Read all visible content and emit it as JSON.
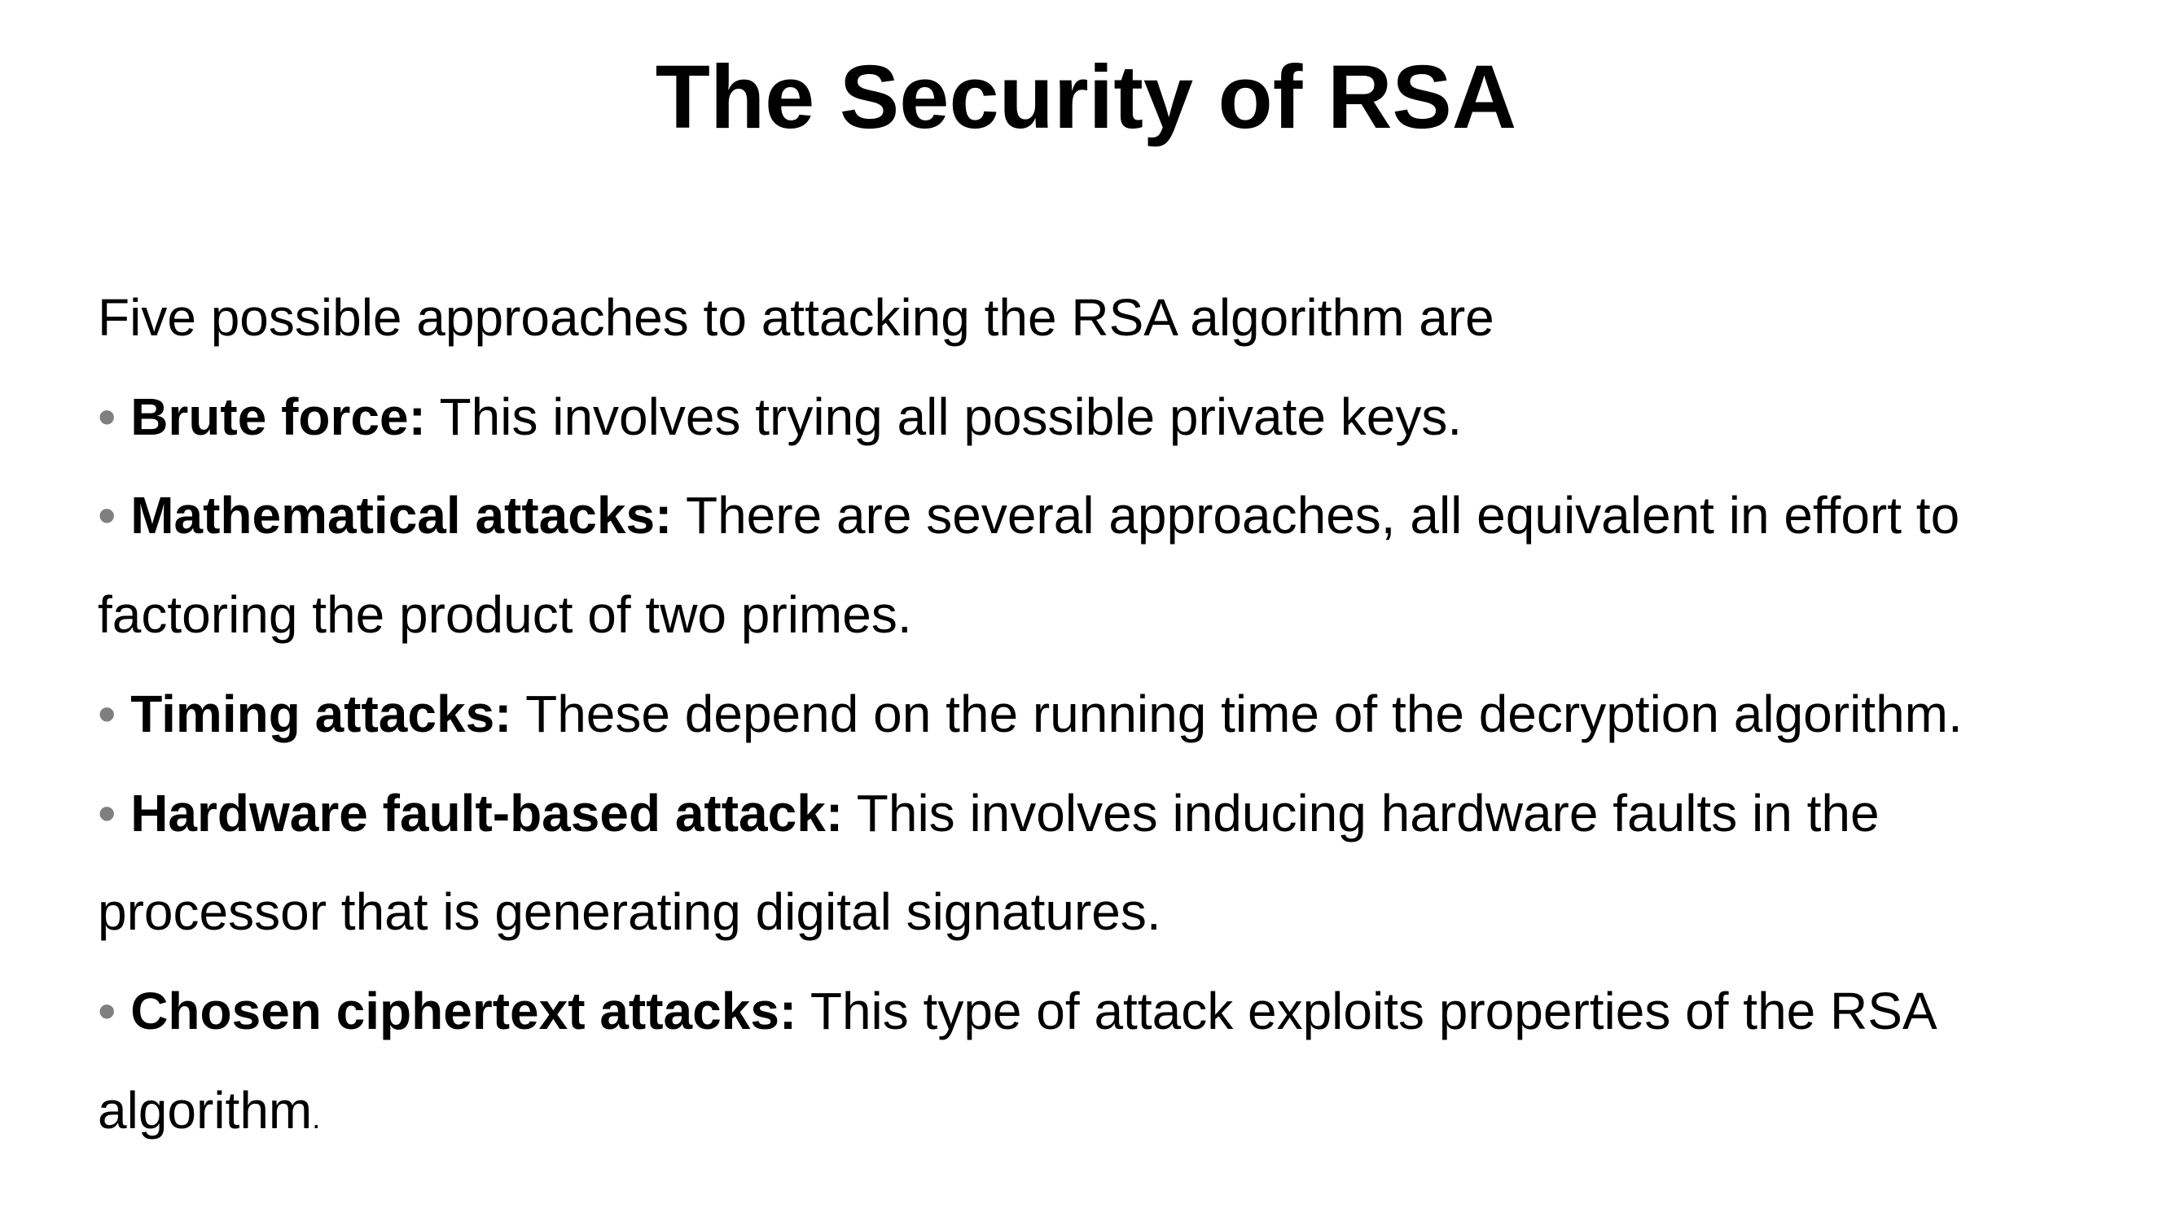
{
  "slide": {
    "title": "The Security of RSA",
    "intro": "Five possible approaches to attacking the RSA algorithm are",
    "bullet_marker": "•",
    "bullets": [
      {
        "term": "Brute force:",
        "text": " This involves trying all possible private keys."
      },
      {
        "term": "Mathematical attacks:",
        "text": " There are several approaches, all equivalent in effort to factoring the product of two primes."
      },
      {
        "term": "Timing attacks:",
        "text": " These depend on the running time of the decryption algorithm."
      },
      {
        "term": "Hardware fault-based attack:",
        "text": " This involves inducing hardware faults in the processor that is generating digital signatures."
      },
      {
        "term": "Chosen ciphertext attacks:",
        "text": " This type of attack exploits properties of the RSA algorithm",
        "trailing": "."
      }
    ]
  },
  "colors": {
    "background": "#ffffff",
    "text": "#000000",
    "bullet": "#7f7f7f"
  }
}
